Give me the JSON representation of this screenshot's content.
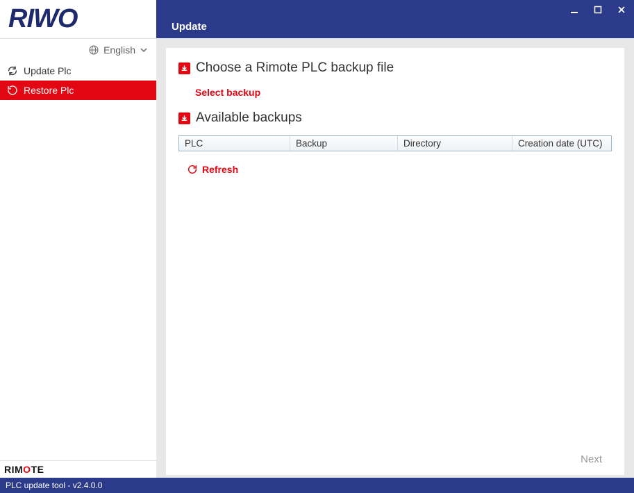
{
  "header": {
    "title": "Update"
  },
  "language": {
    "label": "English"
  },
  "sidebar": {
    "items": [
      {
        "label": "Update Plc"
      },
      {
        "label": "Restore Plc"
      }
    ],
    "footer_prefix": "RIM",
    "footer_accent": "O",
    "footer_suffix": "TE"
  },
  "main": {
    "choose_heading": "Choose a Rimote PLC backup file",
    "select_backup_label": "Select backup",
    "available_heading": "Available backups",
    "columns": {
      "plc": "PLC",
      "backup": "Backup",
      "directory": "Directory",
      "creation": "Creation date (UTC)"
    },
    "refresh_label": "Refresh",
    "next_label": "Next"
  },
  "status": {
    "text": "PLC update tool - v2.4.0.0"
  }
}
